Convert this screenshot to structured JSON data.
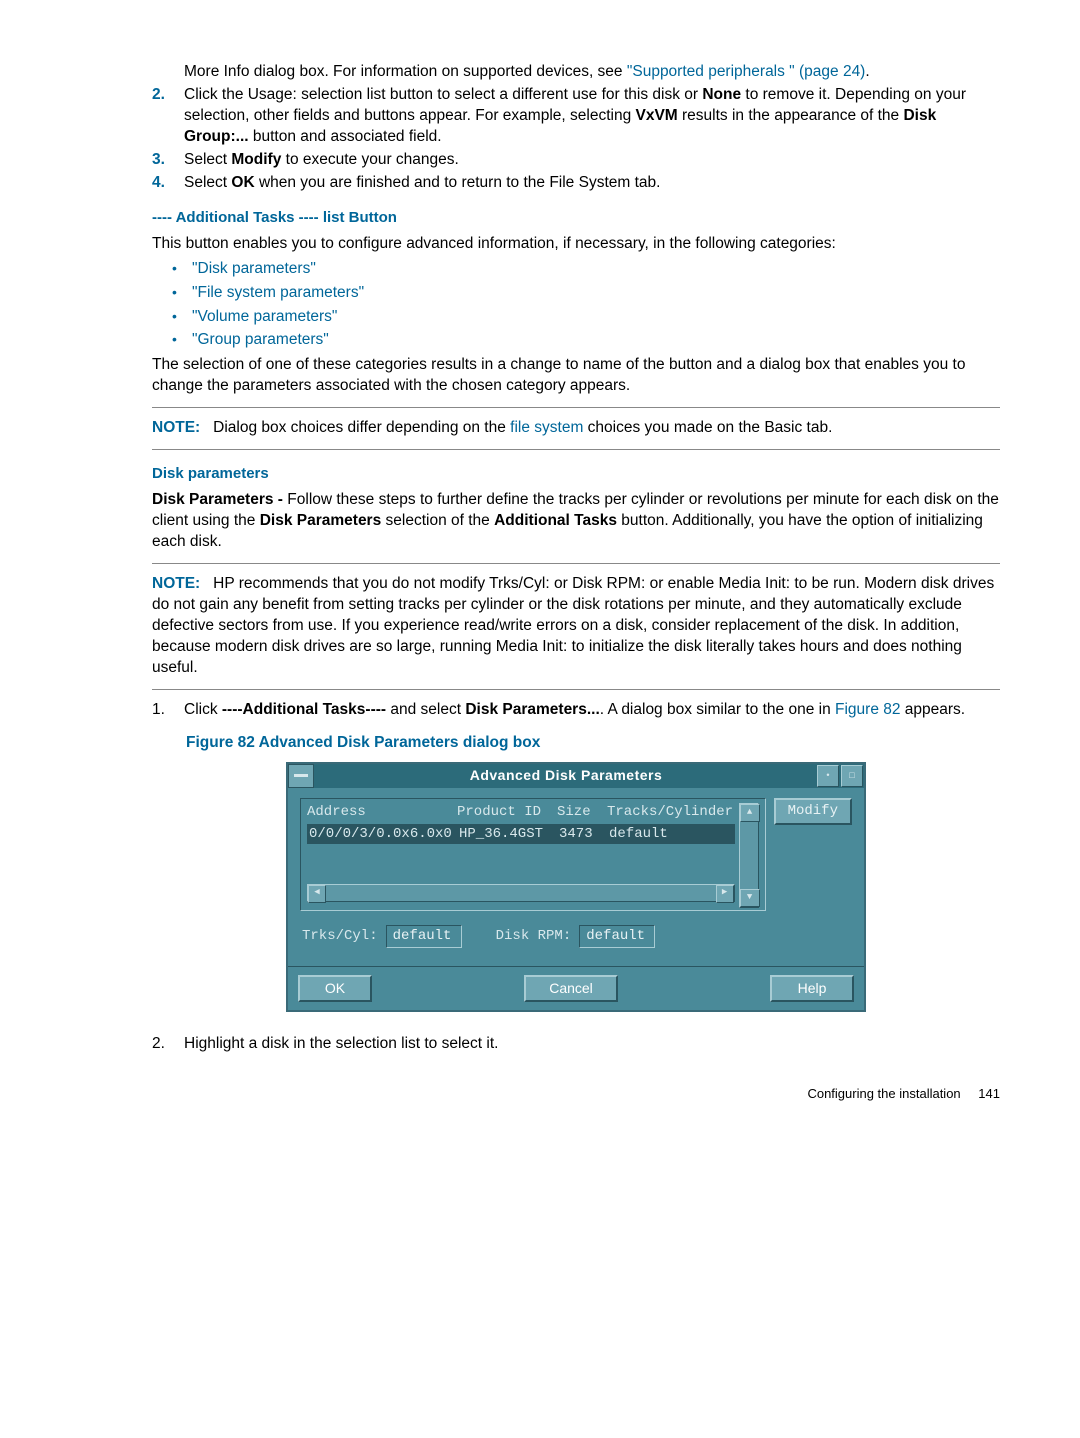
{
  "intro": {
    "line1_a": "More Info dialog box. For information on supported devices, see ",
    "line1_link": "\"Supported peripherals \" (page 24)",
    "line1_b": "."
  },
  "steps_a": [
    {
      "num": "2.",
      "parts": {
        "a": "Click the Usage: selection list button to select a different use for this disk or ",
        "b_bold": "None",
        "c": " to remove it. Depending on your selection, other fields and buttons appear. For example, selecting ",
        "d_bold": "VxVM",
        "e": " results in the appearance of the ",
        "f_bold": "Disk Group:...",
        "g": " button and associated field."
      }
    },
    {
      "num": "3.",
      "parts": {
        "a": "Select ",
        "b_bold": "Modify",
        "c": " to execute your changes."
      }
    },
    {
      "num": "4.",
      "parts": {
        "a": "Select ",
        "b_bold": "OK",
        "c": " when you are finished and to return to the File System tab."
      }
    }
  ],
  "additional_tasks_heading": "---- Additional Tasks ---- list Button",
  "additional_tasks_intro": "This button enables you to configure advanced information, if necessary, in the following categories:",
  "bullet_links": [
    "\"Disk parameters\"",
    "\"File system parameters\"",
    "\"Volume parameters\"",
    "\"Group parameters\""
  ],
  "categories_para": "The selection of one of these categories results in a change to name of the button and a dialog box that enables you to change the parameters associated with the chosen category appears.",
  "note1": {
    "label": "NOTE:",
    "a": "Dialog box choices differ depending on the ",
    "link": "file system",
    "b": " choices you made on the Basic tab."
  },
  "disk_params_heading": "Disk parameters",
  "disk_params_para": {
    "a_bold": "Disk Parameters - ",
    "b": "Follow these steps to further define the tracks per cylinder or revolutions per minute for each disk on the client using the ",
    "c_bold": "Disk Parameters",
    "d": " selection of the ",
    "e_bold": "Additional Tasks",
    "f": " button. Additionally, you have the option of initializing each disk."
  },
  "note2": {
    "label": "NOTE:",
    "body": "HP recommends that you do not modify Trks/Cyl: or Disk RPM: or enable Media Init: to be run. Modern disk drives do not gain any benefit from setting tracks per cylinder or the disk rotations per minute, and they automatically exclude defective sectors from use. If you experience read/write errors on a disk, consider replacement of the disk. In addition, because modern disk drives are so large, running Media Init: to initialize the disk literally takes hours and does nothing useful."
  },
  "steps_b": [
    {
      "num": "1.",
      "parts": {
        "a": "Click ",
        "b_bold": "----Additional Tasks----",
        "c": " and select ",
        "d_bold": "Disk Parameters...",
        "e": ". A dialog box similar to the one in ",
        "link": "Figure 82",
        "f": " appears."
      }
    }
  ],
  "figure_caption": "Figure 82 Advanced Disk Parameters dialog box",
  "dialog": {
    "title": "Advanced Disk Parameters",
    "headers": {
      "address": "Address",
      "product": "Product ID",
      "size": "Size",
      "tracks": "Tracks/Cylinder"
    },
    "row": {
      "address": "0/0/0/3/0.0x6.0x0",
      "product": "HP_36.4GST",
      "size": "3473",
      "tracks": "default"
    },
    "modify": "Modify",
    "trks_label": "Trks/Cyl:",
    "trks_val": "default",
    "rpm_label": "Disk RPM:",
    "rpm_val": "default",
    "ok": "OK",
    "cancel": "Cancel",
    "help": "Help"
  },
  "step_b2": {
    "num": "2.",
    "text": "Highlight a disk in the selection list to select it."
  },
  "footer": {
    "text": "Configuring the installation",
    "page": "141"
  }
}
